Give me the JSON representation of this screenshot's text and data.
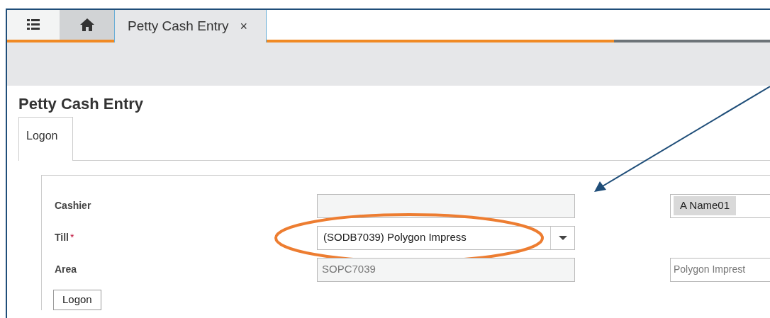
{
  "tabs": [
    {
      "kind": "menu",
      "selected": false
    },
    {
      "kind": "home",
      "selected": false
    },
    {
      "kind": "page",
      "label": "Petty Cash Entry",
      "close": "×",
      "selected": true
    }
  ],
  "page_title": "Petty Cash Entry",
  "section_tabs": [
    {
      "label": "Logon",
      "selected": true
    }
  ],
  "form": {
    "rows": [
      {
        "label": "Cashier",
        "required": false,
        "kind": "text",
        "value": "",
        "side": {
          "kind": "chip",
          "value": "A Name01"
        }
      },
      {
        "label": "Till",
        "required": true,
        "required_mark": "*",
        "kind": "select",
        "value": "(SODB7039) Polygon Impress",
        "highlighted": true
      },
      {
        "label": "Area",
        "required": false,
        "kind": "text",
        "value": "SOPC7039",
        "side": {
          "kind": "text",
          "value": "Polygon Imprest"
        }
      }
    ],
    "submit": "Logon"
  }
}
